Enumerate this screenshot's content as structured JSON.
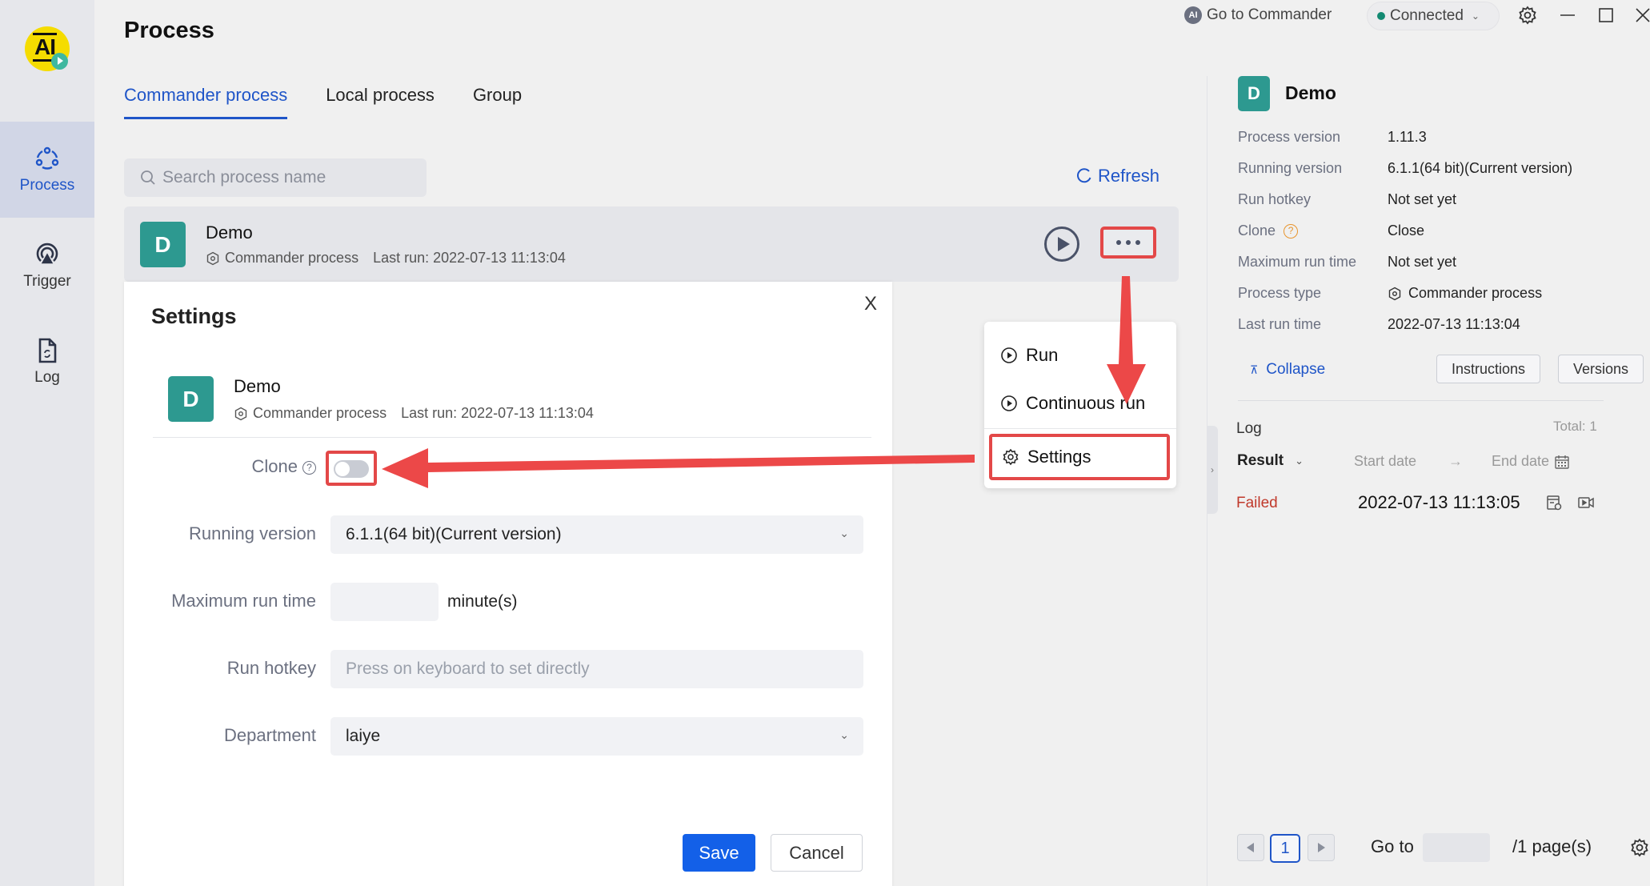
{
  "sidebar": {
    "logo_text": "AI",
    "items": [
      {
        "label": "Process",
        "icon": "process-icon",
        "active": true
      },
      {
        "label": "Trigger",
        "icon": "trigger-icon",
        "active": false
      },
      {
        "label": "Log",
        "icon": "log-icon",
        "active": false
      }
    ]
  },
  "topbar": {
    "goto_commander": "Go to Commander",
    "connection_status": "Connected",
    "status_color": "#138a72",
    "icons": [
      "gear-icon",
      "minimize-icon",
      "maximize-icon",
      "close-icon"
    ]
  },
  "header": {
    "title": "Process",
    "tabs": [
      {
        "label": "Commander process",
        "active": true
      },
      {
        "label": "Local process",
        "active": false
      },
      {
        "label": "Group",
        "active": false
      }
    ],
    "search_placeholder": "Search process name",
    "refresh_label": "Refresh"
  },
  "process": {
    "initial": "D",
    "name": "Demo",
    "type": "Commander process",
    "last_run": "Last run: 2022-07-13 11:13:04",
    "avatar_color": "#2d9990"
  },
  "menu": {
    "items": [
      {
        "label": "Run",
        "icon": "play-circle-icon"
      },
      {
        "label": "Continuous run",
        "icon": "play-circle-icon"
      },
      {
        "label": "Settings",
        "icon": "gear-icon"
      }
    ]
  },
  "dialog": {
    "title": "Settings",
    "close": "X",
    "clone_label": "Clone",
    "clone_help": "?",
    "clone_enabled": false,
    "running_version_label": "Running version",
    "running_version_value": "6.1.1(64 bit)(Current version)",
    "max_run_time_label": "Maximum run time",
    "max_run_time_value": "",
    "max_run_time_unit": "minute(s)",
    "run_hotkey_label": "Run hotkey",
    "run_hotkey_placeholder": "Press on keyboard to set directly",
    "department_label": "Department",
    "department_value": "laiye",
    "save_label": "Save",
    "cancel_label": "Cancel",
    "primary_color": "#1360e8"
  },
  "details": {
    "title": "Demo",
    "rows": [
      {
        "label": "Process version",
        "value": "1.11.3"
      },
      {
        "label": "Running version",
        "value": "6.1.1(64 bit)(Current version)"
      },
      {
        "label": "Run hotkey",
        "value": "Not set yet"
      },
      {
        "label": "Clone",
        "value": "Close"
      },
      {
        "label": "Maximum run time",
        "value": "Not set yet"
      },
      {
        "label": "Process type",
        "value": "Commander process"
      },
      {
        "label": "Last run time",
        "value": "2022-07-13 11:13:04"
      }
    ],
    "collapse_label": "Collapse",
    "instructions_label": "Instructions",
    "versions_label": "Versions"
  },
  "log": {
    "title": "Log",
    "total": "Total: 1",
    "result_filter": "Result",
    "start_date": "Start date",
    "date_separator": "→",
    "end_date": "End date",
    "entries": [
      {
        "status": "Failed",
        "time": "2022-07-13 11:13:05",
        "status_color": "#c0392b"
      }
    ],
    "pagination": {
      "current_page": "1",
      "goto_label": "Go to",
      "goto_value": "",
      "total_pages": "/1 page(s)"
    }
  },
  "annotations": {
    "highlight_color": "#e34848"
  }
}
